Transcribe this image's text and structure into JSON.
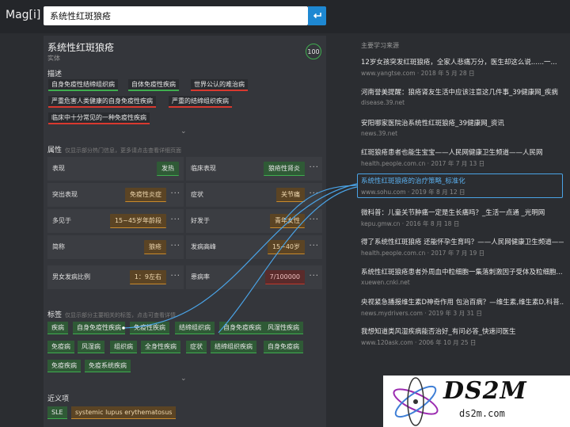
{
  "app": {
    "logo": "Mag[i]"
  },
  "search": {
    "value": "系统性红斑狼疮"
  },
  "entity": {
    "title": "系统性红斑狼疮",
    "type": "实体",
    "score": "100"
  },
  "description": {
    "label": "描述",
    "tags": [
      "自身免疫性结缔组织病",
      "自体免疫性疾病",
      "世界公认的难治病",
      "严重危害人类健康的自身免疫性疾病",
      "严重的结缔组织疾病",
      "临床中十分常见的一种免疫性疾病"
    ]
  },
  "attributes": {
    "label": "属性",
    "hint": "仅显示部分热门信息，更多请点击查看详细页面",
    "rows": [
      {
        "k1": "表现",
        "v1": "发热",
        "k2": "临床表现",
        "v2": "狼疮性肾炎"
      },
      {
        "k1": "突出表现",
        "v1": "免疫性炎症",
        "k2": "症状",
        "v2": "关节痛"
      },
      {
        "k1": "多见于",
        "v1": "15~45岁年龄段",
        "k2": "好发于",
        "v2": "青年女性"
      },
      {
        "k1": "简称",
        "v1": "狼疮",
        "k2": "发病高峰",
        "v2": "15~40岁"
      },
      {
        "k1": "男女发病比例",
        "v1": "1：9左右",
        "k2": "患病率",
        "v2": "7/100000"
      }
    ]
  },
  "tags": {
    "label": "标签",
    "hint": "仅显示部分主要相关的标签，点击可查看详情",
    "items": [
      "疾病",
      "自身免疫性疾病",
      "免疫性疾病",
      "结缔组织病",
      "自身免疫疾病",
      "风湿性疾病",
      "免疫病",
      "风湿病",
      "组织病",
      "全身性疾病",
      "症状",
      "结缔组织疾病",
      "自身免疫病",
      "免疫疾病",
      "免疫系统疾病"
    ]
  },
  "synonyms": {
    "label": "近义项",
    "items": [
      "SLE",
      "systemic lupus erythematosus"
    ]
  },
  "sources": {
    "label": "主要学习来源",
    "items": [
      {
        "title": "12岁女孩突发红斑狼疮，全家人悲痛万分，医生却这么说......一...",
        "meta": "www.yangtse.com · 2018 年 5 月 28 日"
      },
      {
        "title": "河南誉美提醒：狼疮肾友生活中应该注意这几件事_39健康网_疾病",
        "meta": "disease.39.net"
      },
      {
        "title": "安阳哪家医院治系统性红斑狼疮_39健康网_资讯",
        "meta": "news.39.net"
      },
      {
        "title": "红斑狼疮患者也能生宝宝——人民网健康卫生频道——人民网",
        "meta": "health.people.com.cn · 2017 年 7 月 13 日"
      },
      {
        "title": "系统性红斑狼疮的治疗策略_标准化",
        "meta": "www.sohu.com · 2019 年 8 月 12 日"
      },
      {
        "title": "微科普：儿童关节肿痛一定是生长痛吗？_生活一点通 _光明网",
        "meta": "kepu.gmw.cn · 2016 年 8 月 18 日"
      },
      {
        "title": "得了系统性红斑狼疮 还能怀孕生育吗？——人民网健康卫生频道——...",
        "meta": "health.people.com.cn · 2017 年 7 月 19 日"
      },
      {
        "title": "系统性红斑狼疮患者外周血中粒细胞一集落刺激因子受体及粒细胞...",
        "meta": "xuewen.cnki.net"
      },
      {
        "title": "央视紧急播报维生素D神奇作用 包治百病？—维生素,维生素D,科普...",
        "meta": "news.mydrivers.com · 2019 年 3 月 31 日"
      },
      {
        "title": "我想知道类风湿疾病能否治好_有问必答_快速问医生",
        "meta": "www.120ask.com · 2006 年 10 月 25 日"
      }
    ]
  },
  "watermark": {
    "brand": "DS2M",
    "url": "ds2m.com"
  },
  "colors": {
    "accent": "#1e88d2",
    "green": "#3fae4f",
    "red": "#d9392f",
    "orange": "#c98a2c",
    "highlight": "#4aa3e6"
  }
}
